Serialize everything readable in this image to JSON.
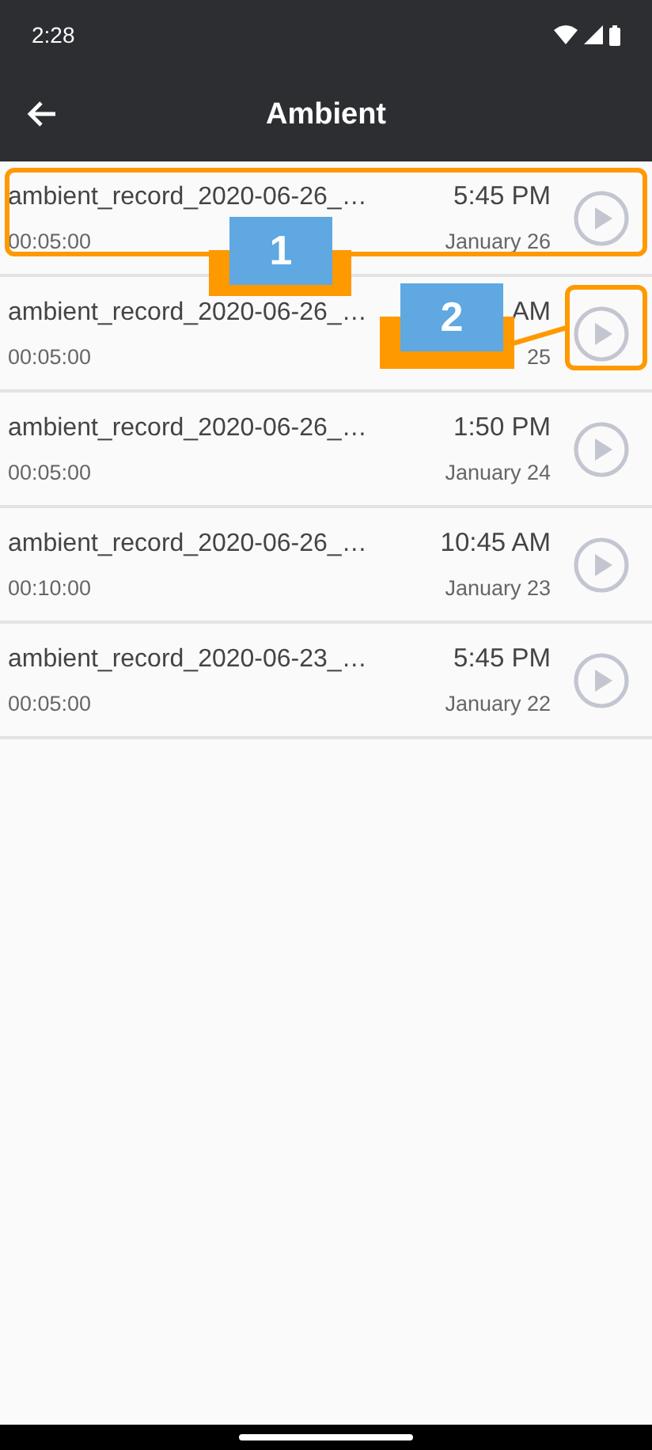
{
  "status_bar": {
    "time": "2:28"
  },
  "app_bar": {
    "title": "Ambient"
  },
  "recordings": [
    {
      "name": "ambient_record_2020-06-26_…",
      "duration": "00:05:00",
      "time": "5:45 PM",
      "date": "January 26"
    },
    {
      "name": "ambient_record_2020-06-26_…",
      "duration": "00:05:00",
      "time": "AM",
      "date": "25"
    },
    {
      "name": "ambient_record_2020-06-26_…",
      "duration": "00:05:00",
      "time": "1:50 PM",
      "date": "January 24"
    },
    {
      "name": "ambient_record_2020-06-26_…",
      "duration": "00:10:00",
      "time": "10:45 AM",
      "date": "January 23"
    },
    {
      "name": "ambient_record_2020-06-23_…",
      "duration": "00:05:00",
      "time": "5:45 PM",
      "date": "January 22"
    }
  ],
  "annotations": [
    {
      "kind": "row",
      "number": "1"
    },
    {
      "kind": "button",
      "number": "2"
    }
  ]
}
